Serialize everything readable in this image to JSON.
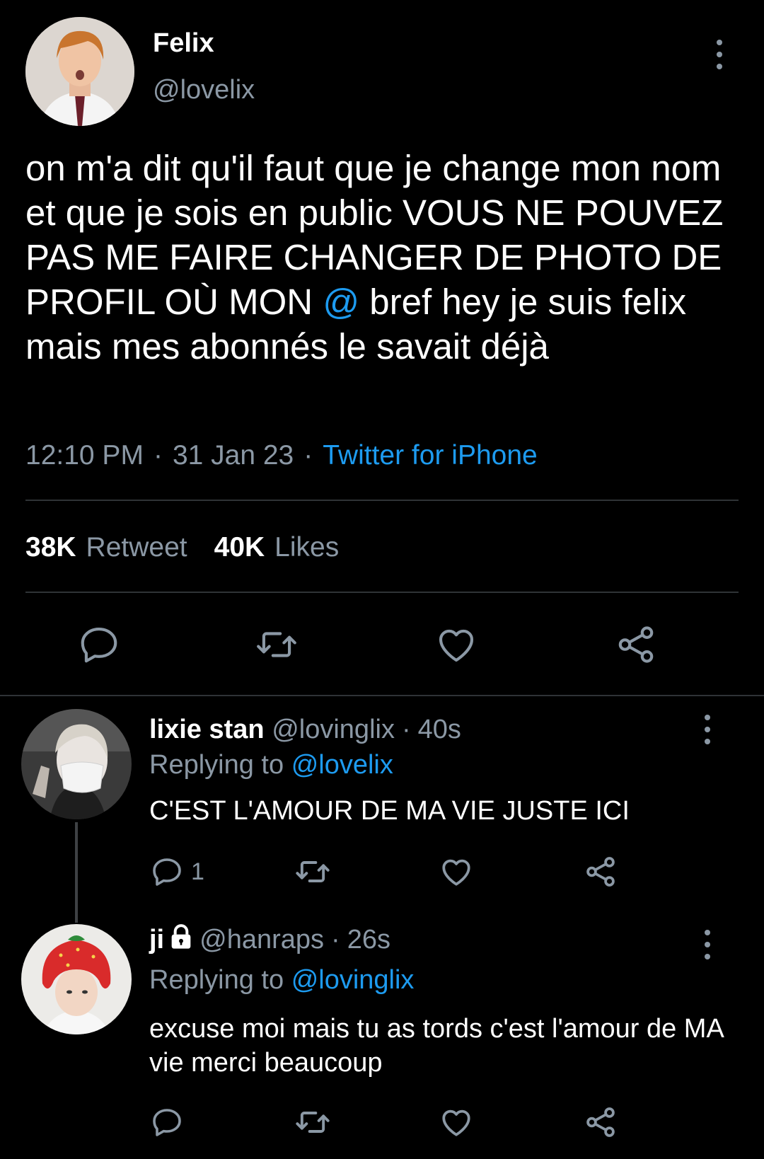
{
  "tweet": {
    "author_name": "Felix",
    "author_handle": "@lovelix",
    "text_before": "on m'a dit qu'il faut que je change mon nom et que je sois en public VOUS NE POUVEZ PAS ME FAIRE CHANGER DE PHOTO DE PROFIL OÙ MON ",
    "text_mention": "@",
    "text_after": " bref hey je suis felix mais mes abonnés le savait déjà",
    "time": "12:10 PM",
    "date": "31 Jan 23",
    "source": "Twitter for iPhone",
    "separator": "·",
    "retweets_count": "38K",
    "retweets_label": "Retweet",
    "likes_count": "40K",
    "likes_label": "Likes"
  },
  "replies": [
    {
      "name": "lixie stan",
      "handle": "@lovinglix",
      "time": "40s",
      "replying_label": "Replying to",
      "replying_to": "@lovelix",
      "text": "C'EST L'AMOUR DE MA VIE JUSTE ICI",
      "reply_count": "1"
    },
    {
      "name": "ji",
      "handle": "@hanraps",
      "time": "26s",
      "replying_label": "Replying to",
      "replying_to": "@lovinglix",
      "text": "excuse moi mais tu as tords c'est l'amour de MA vie merci beaucoup",
      "reply_count": ""
    }
  ],
  "icons": {
    "reply": "reply-icon",
    "retweet": "retweet-icon",
    "like": "heart-icon",
    "share": "share-icon",
    "more": "more-vertical-icon",
    "lock": "lock-icon"
  },
  "colors": {
    "background": "#000000",
    "text": "#ffffff",
    "muted": "#8b98a5",
    "accent": "#1d9bf0",
    "divider": "#2f3336"
  }
}
